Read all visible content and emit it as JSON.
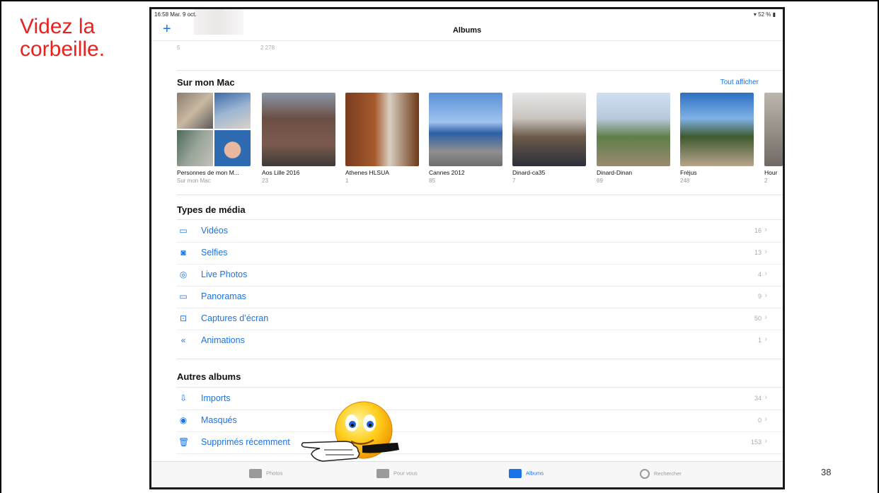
{
  "caption": "Videz la\ncorbeille.",
  "slide_number": "38",
  "status": {
    "time": "16:58  Mar. 9 oct.",
    "battery": "▾ 52 % ▮"
  },
  "navbar": {
    "title": "Albums",
    "add_icon": "plus-icon"
  },
  "previous_counts": [
    "5",
    "2 278"
  ],
  "sur_mon_mac": {
    "title": "Sur mon Mac",
    "see_all": "Tout afficher",
    "albums": [
      {
        "name": "Personnes de mon M...",
        "count": "Sur mon Mac"
      },
      {
        "name": "Aos Lille 2016",
        "count": "23"
      },
      {
        "name": "Athenes HLSUA",
        "count": "1"
      },
      {
        "name": "Cannes 2012",
        "count": "85"
      },
      {
        "name": "Dinard-ca35",
        "count": "7"
      },
      {
        "name": "Dinard-Dinan",
        "count": "69"
      },
      {
        "name": "Fréjus",
        "count": "248"
      },
      {
        "name": "Hour",
        "count": "2"
      }
    ]
  },
  "media_types": {
    "title": "Types de média",
    "items": [
      {
        "label": "Vidéos",
        "count": "16",
        "icon": "video-icon"
      },
      {
        "label": "Selfies",
        "count": "13",
        "icon": "selfie-icon"
      },
      {
        "label": "Live Photos",
        "count": "4",
        "icon": "live-photo-icon"
      },
      {
        "label": "Panoramas",
        "count": "9",
        "icon": "panorama-icon"
      },
      {
        "label": "Captures d’écran",
        "count": "50",
        "icon": "screenshot-icon"
      },
      {
        "label": "Animations",
        "count": "1",
        "icon": "animation-icon"
      }
    ]
  },
  "other_albums": {
    "title": "Autres albums",
    "items": [
      {
        "label": "Imports",
        "count": "34",
        "icon": "import-icon"
      },
      {
        "label": "Masqués",
        "count": "0",
        "icon": "hidden-eye-icon"
      },
      {
        "label": "Supprimés récemment",
        "count": "153",
        "icon": "trash-icon"
      }
    ]
  },
  "tabs": [
    {
      "label": "Photos",
      "active": false
    },
    {
      "label": "Pour vous",
      "active": false
    },
    {
      "label": "Albums",
      "active": true
    },
    {
      "label": "Rechercher",
      "active": false
    }
  ],
  "colors": {
    "accent": "#1a73e8",
    "caption": "#e8221f"
  }
}
